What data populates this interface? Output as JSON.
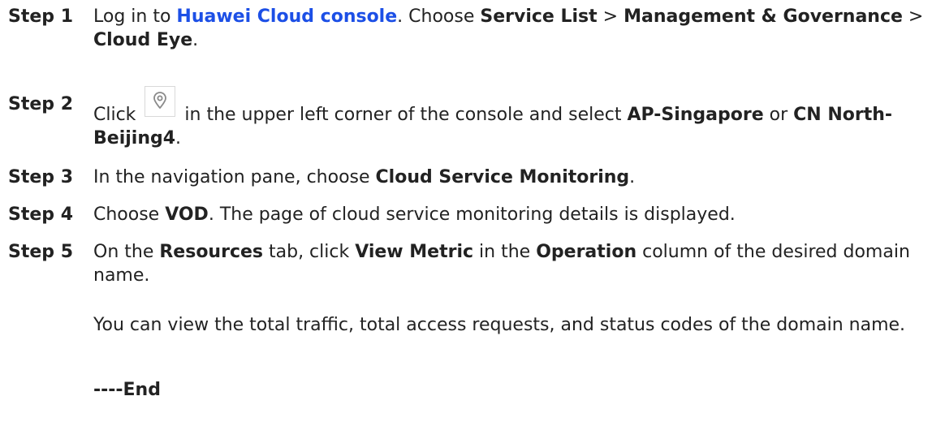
{
  "steps": [
    {
      "label": "Step 1",
      "t1": "Log in to ",
      "link": "Huawei Cloud console",
      "t2": ". Choose ",
      "b1": "Service List",
      "t3": " > ",
      "b2": "Management & Governance",
      "t4": " > ",
      "b3": "Cloud Eye",
      "t5": "."
    },
    {
      "label": "Step 2",
      "t1": "Click ",
      "icon": "location-pin-icon",
      "t2": " in the upper left corner of the console and select ",
      "b1": "AP-Singapore",
      "t3": " or ",
      "b2": "CN North-Beijing4",
      "t4": "."
    },
    {
      "label": "Step 3",
      "t1": "In the navigation pane, choose ",
      "b1": "Cloud Service Monitoring",
      "t2": "."
    },
    {
      "label": "Step 4",
      "t1": "Choose ",
      "b1": "VOD",
      "t2": ". The page of cloud service monitoring details is displayed."
    },
    {
      "label": "Step 5",
      "t1": "On the ",
      "b1": "Resources",
      "t2": " tab, click ",
      "b2": "View Metric",
      "t3": " in the ",
      "b3": "Operation",
      "t4": " column of the desired domain name."
    }
  ],
  "note": "You can view the total traffic, total access requests, and status codes of the domain name.",
  "end": "----End"
}
